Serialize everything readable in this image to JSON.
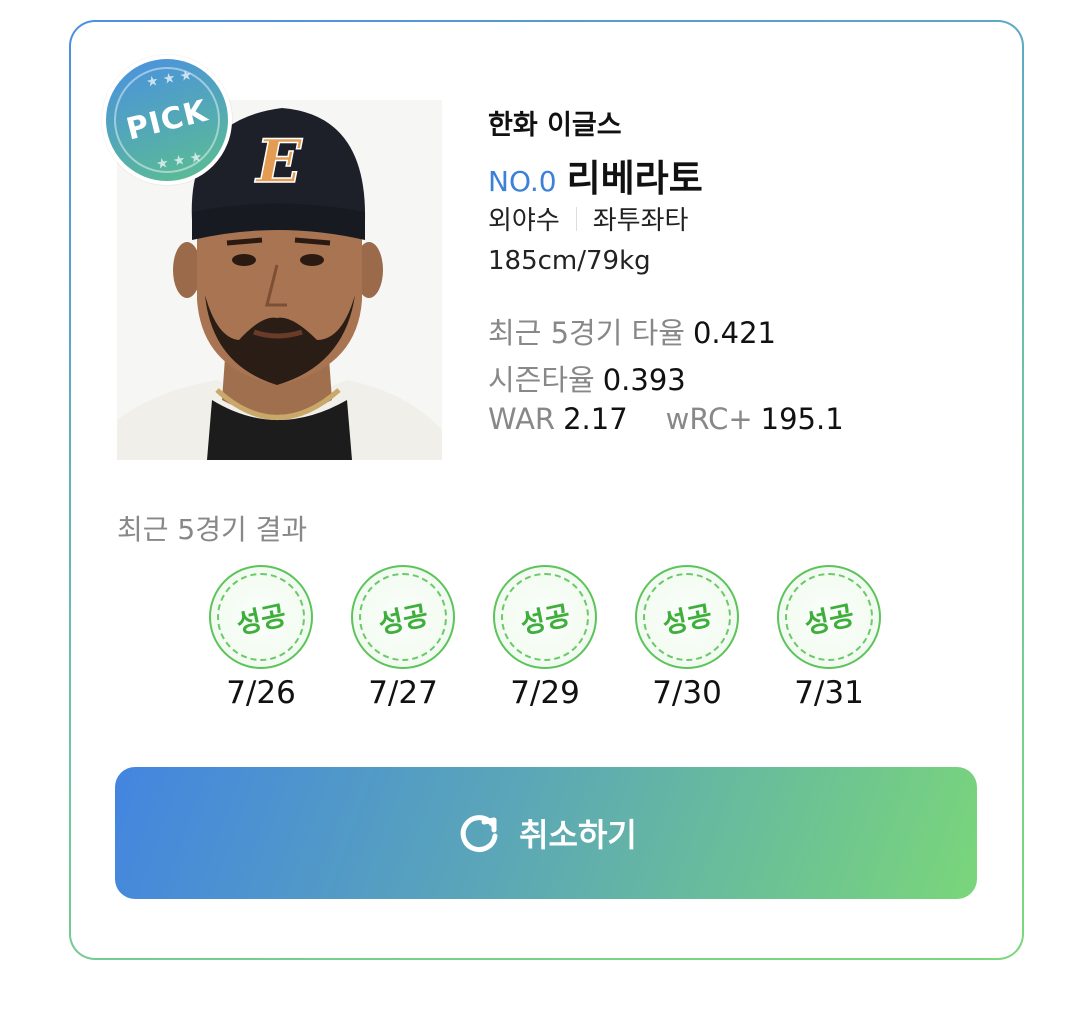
{
  "badge": {
    "label": "PICK"
  },
  "player": {
    "team": "한화 이글스",
    "number": "NO.0",
    "name": "리베라토",
    "position": "외야수",
    "bat_throw": "좌투좌타",
    "body": "185cm/79kg"
  },
  "stats": {
    "recent_avg_label": "최근 5경기 타율",
    "recent_avg_value": "0.421",
    "season_avg_label": "시즌타율",
    "season_avg_value": "0.393",
    "war_label": "WAR",
    "war_value": "2.17",
    "wrc_label": "wRC+",
    "wrc_value": "195.1"
  },
  "recent_results": {
    "title": "최근 5경기 결과",
    "items": [
      {
        "result": "성공",
        "date": "7/26"
      },
      {
        "result": "성공",
        "date": "7/27"
      },
      {
        "result": "성공",
        "date": "7/29"
      },
      {
        "result": "성공",
        "date": "7/30"
      },
      {
        "result": "성공",
        "date": "7/31"
      }
    ]
  },
  "actions": {
    "cancel_label": "취소하기",
    "cancel_icon": "refresh-icon"
  },
  "colors": {
    "accent_blue": "#4385e0",
    "accent_green": "#7ad67a",
    "success_green": "#3fae3c"
  }
}
